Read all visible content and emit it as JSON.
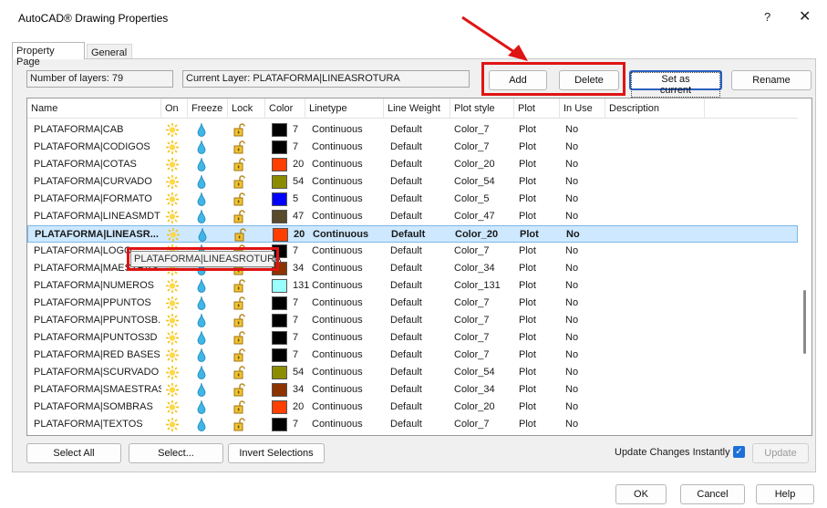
{
  "window": {
    "title": "AutoCAD® Drawing Properties",
    "help": "?",
    "close": "✕"
  },
  "tabs": [
    {
      "label": "Property Page"
    },
    {
      "label": "General"
    }
  ],
  "info": {
    "layers_count": "Number of layers: 79",
    "current_layer": "Current Layer: PLATAFORMA|LINEASROTURA"
  },
  "actions": {
    "add": "Add",
    "delete": "Delete",
    "set_current": "Set as current",
    "rename": "Rename"
  },
  "columns": [
    "Name",
    "On",
    "Freeze",
    "Lock",
    "Color",
    "Linetype",
    "Line Weight",
    "Plot style",
    "Plot",
    "In Use",
    "Description"
  ],
  "layers": [
    {
      "name": "PLATAFORMA|CAB",
      "color": "7",
      "swatch": "#000000",
      "linetype": "Continuous",
      "weight": "Default",
      "style": "Color_7",
      "plot": "Plot",
      "inuse": "No"
    },
    {
      "name": "PLATAFORMA|CODIGOS",
      "color": "7",
      "swatch": "#000000",
      "linetype": "Continuous",
      "weight": "Default",
      "style": "Color_7",
      "plot": "Plot",
      "inuse": "No"
    },
    {
      "name": "PLATAFORMA|COTAS",
      "color": "20",
      "swatch": "#ff3f00",
      "linetype": "Continuous",
      "weight": "Default",
      "style": "Color_20",
      "plot": "Plot",
      "inuse": "No"
    },
    {
      "name": "PLATAFORMA|CURVADO",
      "color": "54",
      "swatch": "#8c8c00",
      "linetype": "Continuous",
      "weight": "Default",
      "style": "Color_54",
      "plot": "Plot",
      "inuse": "No"
    },
    {
      "name": "PLATAFORMA|FORMATO",
      "color": "5",
      "swatch": "#0000ff",
      "linetype": "Continuous",
      "weight": "Default",
      "style": "Color_5",
      "plot": "Plot",
      "inuse": "No"
    },
    {
      "name": "PLATAFORMA|LINEASMDT",
      "color": "47",
      "swatch": "#594a2c",
      "linetype": "Continuous",
      "weight": "Default",
      "style": "Color_47",
      "plot": "Plot",
      "inuse": "No"
    },
    {
      "name": "PLATAFORMA|LINEASR...",
      "color": "20",
      "swatch": "#ff3f00",
      "linetype": "Continuous",
      "weight": "Default",
      "style": "Color_20",
      "plot": "Plot",
      "inuse": "No",
      "selected": true
    },
    {
      "name": "PLATAFORMA|LOGO",
      "color": "7",
      "swatch": "#000000",
      "linetype": "Continuous",
      "weight": "Default",
      "style": "Color_7",
      "plot": "Plot",
      "inuse": "No"
    },
    {
      "name": "PLATAFORMA|MAESTRAS",
      "color": "34",
      "swatch": "#8c3300",
      "linetype": "Continuous",
      "weight": "Default",
      "style": "Color_34",
      "plot": "Plot",
      "inuse": "No"
    },
    {
      "name": "PLATAFORMA|NUMEROS",
      "color": "131",
      "swatch": "#99ffff",
      "linetype": "Continuous",
      "weight": "Default",
      "style": "Color_131",
      "plot": "Plot",
      "inuse": "No"
    },
    {
      "name": "PLATAFORMA|PPUNTOS",
      "color": "7",
      "swatch": "#000000",
      "linetype": "Continuous",
      "weight": "Default",
      "style": "Color_7",
      "plot": "Plot",
      "inuse": "No"
    },
    {
      "name": "PLATAFORMA|PPUNTOSB...",
      "color": "7",
      "swatch": "#000000",
      "linetype": "Continuous",
      "weight": "Default",
      "style": "Color_7",
      "plot": "Plot",
      "inuse": "No"
    },
    {
      "name": "PLATAFORMA|PUNTOS3D",
      "color": "7",
      "swatch": "#000000",
      "linetype": "Continuous",
      "weight": "Default",
      "style": "Color_7",
      "plot": "Plot",
      "inuse": "No"
    },
    {
      "name": "PLATAFORMA|RED BASES",
      "color": "7",
      "swatch": "#000000",
      "linetype": "Continuous",
      "weight": "Default",
      "style": "Color_7",
      "plot": "Plot",
      "inuse": "No"
    },
    {
      "name": "PLATAFORMA|SCURVADO",
      "color": "54",
      "swatch": "#8c8c00",
      "linetype": "Continuous",
      "weight": "Default",
      "style": "Color_54",
      "plot": "Plot",
      "inuse": "No"
    },
    {
      "name": "PLATAFORMA|SMAESTRAS",
      "color": "34",
      "swatch": "#8c3300",
      "linetype": "Continuous",
      "weight": "Default",
      "style": "Color_34",
      "plot": "Plot",
      "inuse": "No"
    },
    {
      "name": "PLATAFORMA|SOMBRAS",
      "color": "20",
      "swatch": "#ff3f00",
      "linetype": "Continuous",
      "weight": "Default",
      "style": "Color_20",
      "plot": "Plot",
      "inuse": "No"
    },
    {
      "name": "PLATAFORMA|TEXTOS",
      "color": "7",
      "swatch": "#000000",
      "linetype": "Continuous",
      "weight": "Default",
      "style": "Color_7",
      "plot": "Plot",
      "inuse": "No"
    }
  ],
  "tooltip": "PLATAFORMA|LINEASROTURA",
  "bottom": {
    "select_all": "Select All",
    "select": "Select...",
    "invert": "Invert Selections",
    "update_instantly": "Update Changes Instantly",
    "update": "Update"
  },
  "footer": {
    "ok": "OK",
    "cancel": "Cancel",
    "help": "Help"
  },
  "icons": {
    "on": "lightbulb-icon",
    "freeze": "droplet-icon",
    "lock": "padlock-icon"
  },
  "accent": "#e01313"
}
